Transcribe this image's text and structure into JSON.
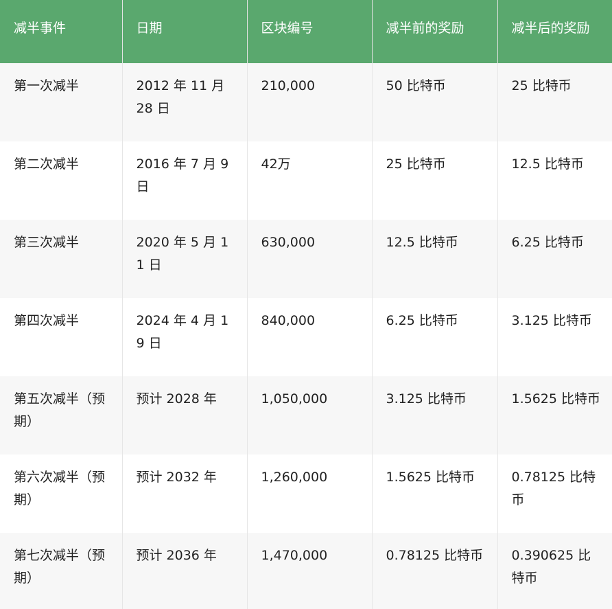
{
  "table": {
    "headers": [
      "减半事件",
      "日期",
      "区块编号",
      "减半前的奖励",
      "减半后的奖励"
    ],
    "rows": [
      [
        "第一次减半",
        "2012 年 11 月 28 日",
        "210,000",
        "50 比特币",
        "25 比特币"
      ],
      [
        "第二次减半",
        "2016 年 7 月 9 日",
        "42万",
        "25 比特币",
        "12.5 比特币"
      ],
      [
        "第三次减半",
        "2020 年 5 月 11 日",
        "630,000",
        "12.5 比特币",
        "6.25 比特币"
      ],
      [
        "第四次减半",
        "2024 年 4 月 19 日",
        "840,000",
        "6.25 比特币",
        "3.125 比特币"
      ],
      [
        "第五次减半（预期）",
        "预计 2028 年",
        "1,050,000",
        "3.125 比特币",
        "1.5625 比特币"
      ],
      [
        "第六次减半（预期）",
        "预计 2032 年",
        "1,260,000",
        "1.5625 比特币",
        "0.78125 比特币"
      ],
      [
        "第七次减半（预期）",
        "预计 2036 年",
        "1,470,000",
        "0.78125 比特币",
        "0.390625 比特币"
      ]
    ]
  },
  "colors": {
    "header_background": "#5aa86e",
    "header_text": "#ffffff",
    "row_stripe": "#f7f7f7",
    "row_plain": "#ffffff"
  }
}
